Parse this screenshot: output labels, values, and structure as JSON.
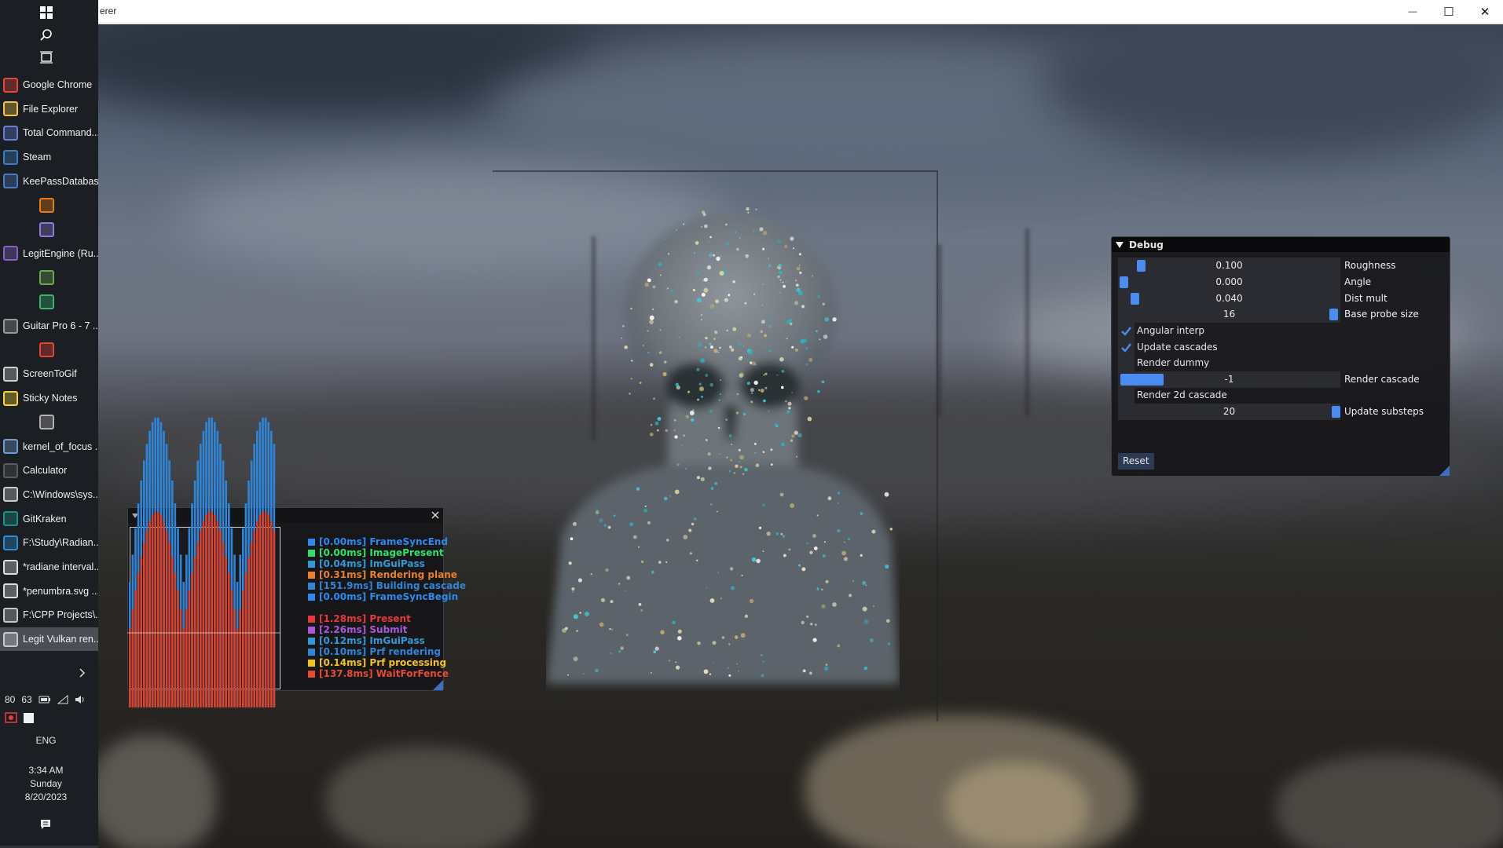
{
  "taskbar": {
    "apps": [
      {
        "label": "Google Chrome",
        "icon": "chrome-icon",
        "color": "#e8453c"
      },
      {
        "label": "File Explorer",
        "icon": "folder-icon",
        "color": "#f2c14e"
      },
      {
        "label": "Total Command...",
        "icon": "floppy-icon",
        "color": "#6a7dd1"
      },
      {
        "label": "Steam",
        "icon": "steam-icon",
        "color": "#3b7dc4"
      },
      {
        "label": "KeePassDatabas...",
        "icon": "lock-icon",
        "color": "#4d78c4"
      },
      {
        "label": "",
        "icon": "blender-icon",
        "color": "#e87d0d"
      },
      {
        "label": "",
        "icon": "doc-icon",
        "color": "#8c7ad8"
      },
      {
        "label": "LegitEngine (Ru...",
        "icon": "visual-studio-icon",
        "color": "#8661c5"
      },
      {
        "label": "",
        "icon": "paint-icon",
        "color": "#6aa84f"
      },
      {
        "label": "",
        "icon": "user-app-icon",
        "color": "#3cb371"
      },
      {
        "label": "Guitar Pro 6 - 7 ...",
        "icon": "guitar-icon",
        "color": "#9a9a9a"
      },
      {
        "label": "",
        "icon": "yandex-icon",
        "color": "#e84235"
      },
      {
        "label": "ScreenToGif",
        "icon": "screen-icon",
        "color": "#d0d0d0"
      },
      {
        "label": "Sticky Notes",
        "icon": "note-icon",
        "color": "#f7d33b"
      },
      {
        "label": "",
        "icon": "window-app-icon",
        "color": "#b0b0b0"
      },
      {
        "label": "kernel_of_focus ...",
        "icon": "image-viewer-icon",
        "color": "#6f9bd3"
      },
      {
        "label": "Calculator",
        "icon": "calculator-icon",
        "color": "#5a5a5a"
      },
      {
        "label": "C:\\Windows\\sys...",
        "icon": "terminal-icon",
        "color": "#cccccc"
      },
      {
        "label": "GitKraken",
        "icon": "gitkraken-icon",
        "color": "#179287"
      },
      {
        "label": "F:\\Study\\Radian...",
        "icon": "vscode-icon",
        "color": "#2c8fd6"
      },
      {
        "label": "*radiane interval...",
        "icon": "inkscape-icon",
        "color": "#dddddd"
      },
      {
        "label": "*penumbra.svg ...",
        "icon": "inkscape-icon",
        "color": "#dddddd"
      },
      {
        "label": "F:\\CPP Projects\\...",
        "icon": "app-window-icon",
        "color": "#c8c8c8"
      },
      {
        "label": "Legit Vulkan ren...",
        "icon": "app-window-icon",
        "color": "#c8c8c8"
      }
    ],
    "tray": {
      "num1": "80",
      "num2": "63",
      "language": "ENG",
      "time": "3:34 AM",
      "day": "Sunday",
      "date": "8/20/2023"
    }
  },
  "window": {
    "title": "erer",
    "minimize": "—",
    "maximize": "☐",
    "close": "✕"
  },
  "debug": {
    "title": "Debug",
    "rows": [
      {
        "kind": "slider",
        "value": "0.100",
        "label": "Roughness"
      },
      {
        "kind": "slider",
        "value": "0.000",
        "label": "Angle"
      },
      {
        "kind": "slider",
        "value": "0.040",
        "label": "Dist mult"
      },
      {
        "kind": "slider",
        "value": "16",
        "label": "Base probe size"
      },
      {
        "kind": "checkbox",
        "checked": true,
        "label": "Angular interp"
      },
      {
        "kind": "checkbox",
        "checked": true,
        "label": "Update cascades"
      },
      {
        "kind": "checkbox",
        "checked": false,
        "label": "Render dummy"
      },
      {
        "kind": "slider",
        "value": "-1",
        "label": "Render cascade"
      },
      {
        "kind": "checkbox",
        "checked": false,
        "label": "Render 2d cascade"
      },
      {
        "kind": "slider",
        "value": "20",
        "label": "Update substeps"
      }
    ],
    "reset": "Reset",
    "accent": "#4a8cf0"
  },
  "profiler": {
    "legend": [
      {
        "text": "[0.00ms] FrameSyncEnd",
        "color": "#2a8af0"
      },
      {
        "text": "[0.00ms] ImagePresent",
        "color": "#2ee06a"
      },
      {
        "text": "[0.04ms] ImGuiPass",
        "color": "#2f9ad8"
      },
      {
        "text": "[0.31ms] Rendering plane",
        "color": "#e8812a"
      },
      {
        "text": "[151.9ms] Building cascade",
        "color": "#2f86d8"
      },
      {
        "text": "[0.00ms] FrameSyncBegin",
        "color": "#2a8af0"
      },
      {
        "text": "",
        "color": ""
      },
      {
        "text": "[1.28ms] Present",
        "color": "#e83838"
      },
      {
        "text": "[2.26ms] Submit",
        "color": "#a858d8"
      },
      {
        "text": "[0.12ms] ImGuiPass",
        "color": "#2f9ad8"
      },
      {
        "text": "[0.10ms] Prf rendering",
        "color": "#2f86d8"
      },
      {
        "text": "[0.14ms] Prf processing",
        "color": "#f2c21a"
      },
      {
        "text": "[137.8ms] WaitForFence",
        "color": "#e84a32"
      }
    ],
    "colors": {
      "cpu": "#2f86d8",
      "gpu": "#d8422c"
    }
  }
}
